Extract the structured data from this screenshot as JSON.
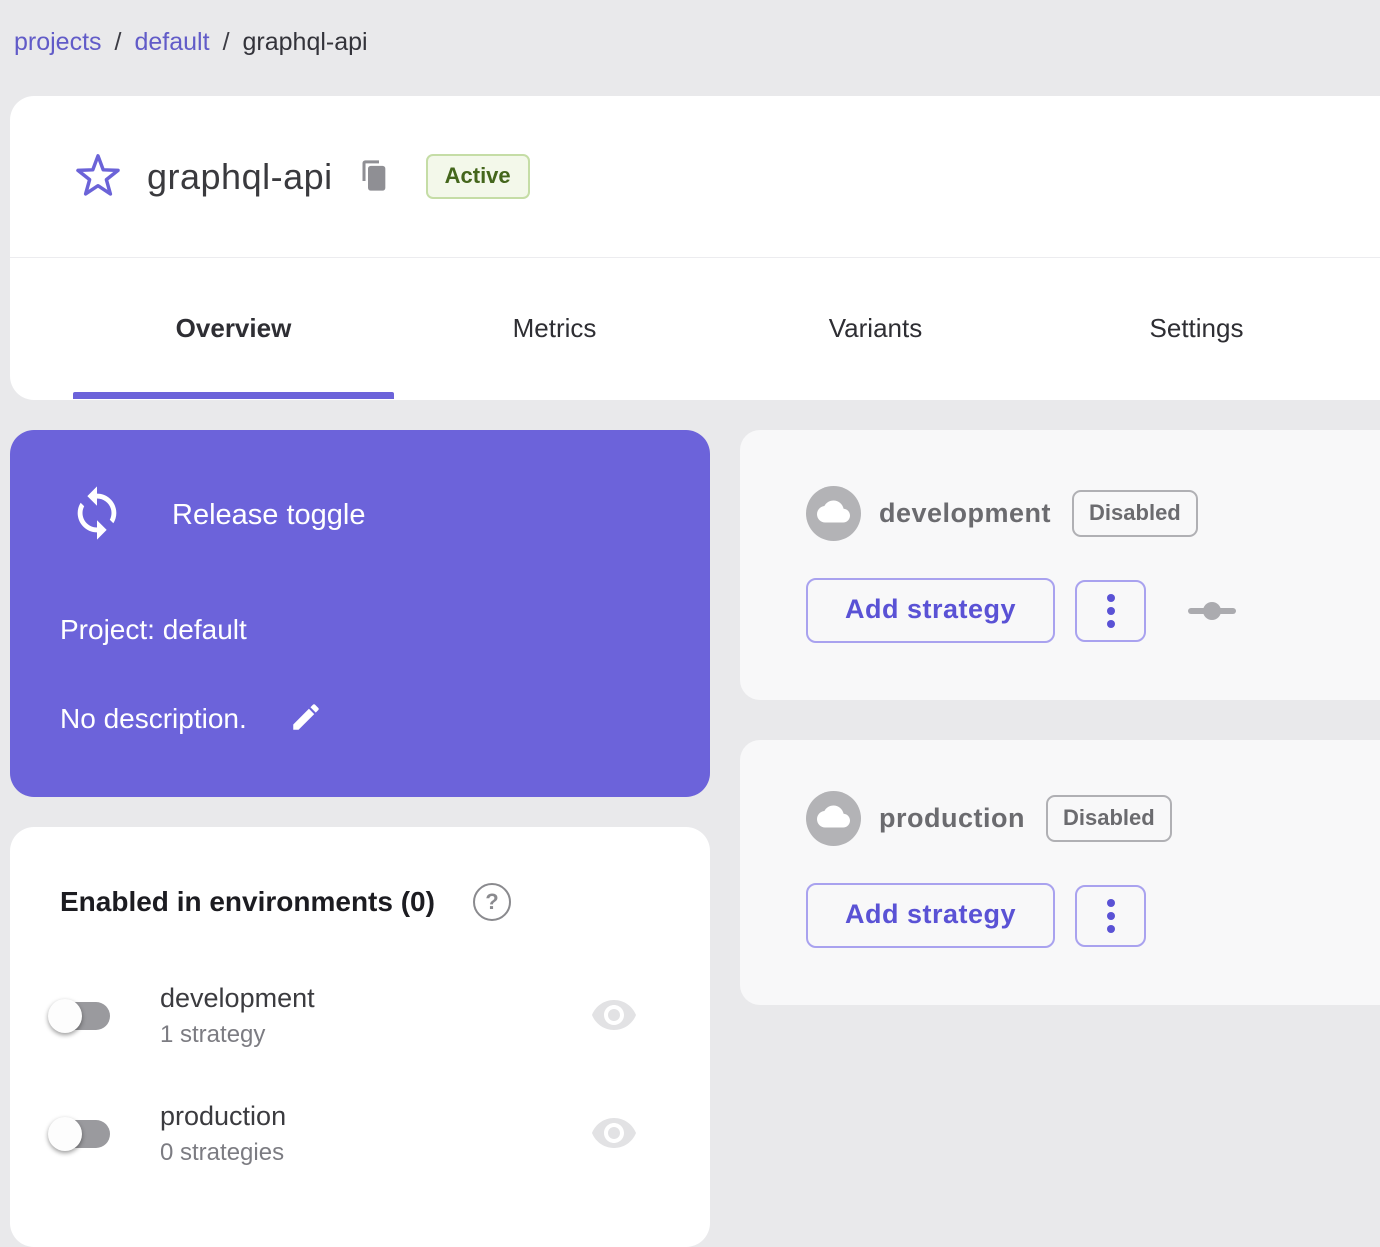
{
  "breadcrumb": {
    "separator": "/",
    "items": [
      {
        "label": "projects"
      },
      {
        "label": "default"
      },
      {
        "label": "graphql-api"
      }
    ]
  },
  "header": {
    "title": "graphql-api",
    "status": "Active",
    "tabs": [
      {
        "label": "Overview"
      },
      {
        "label": "Metrics"
      },
      {
        "label": "Variants"
      },
      {
        "label": "Settings"
      }
    ]
  },
  "toggle_card": {
    "type_label": "Release toggle",
    "project": "Project: default",
    "description": "No description."
  },
  "environments_panel": {
    "title": "Enabled in environments (0)",
    "help_glyph": "?",
    "rows": [
      {
        "name": "development",
        "strategies": "1 strategy"
      },
      {
        "name": "production",
        "strategies": "0 strategies"
      }
    ]
  },
  "environment_cards": [
    {
      "name": "development",
      "status": "Disabled",
      "add_strategy_label": "Add strategy"
    },
    {
      "name": "production",
      "status": "Disabled",
      "add_strategy_label": "Add strategy"
    }
  ],
  "colors": {
    "accent_purple": "#6c63da",
    "link_purple": "#615bc8",
    "active_badge_text": "#44661c",
    "active_badge_bg": "#f3f8ea",
    "active_badge_border": "#c5dda6",
    "page_bg": "#e9e9eb",
    "disabled_gray": "#6b6b6f"
  }
}
